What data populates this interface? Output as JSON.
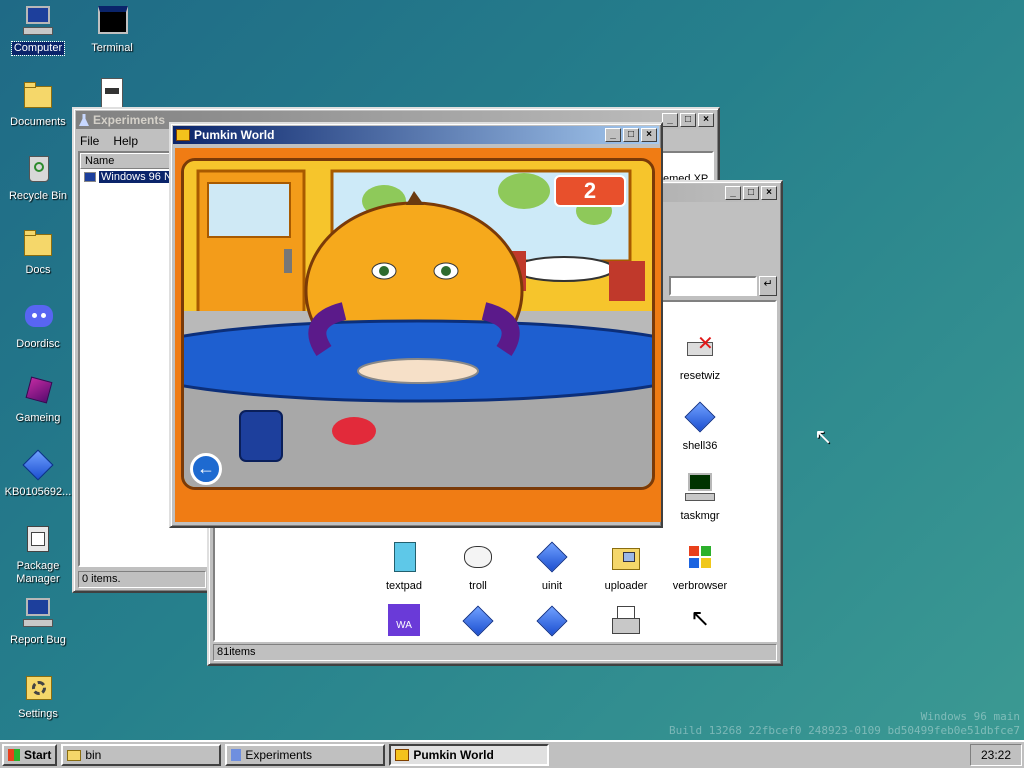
{
  "desktop": {
    "icons": [
      {
        "label": "Computer",
        "icon": "computer-icon"
      },
      {
        "label": "Terminal",
        "icon": "terminal-icon"
      },
      {
        "label": "Documents",
        "icon": "folder-icon"
      },
      {
        "label": "Recycle Bin",
        "icon": "recycle-bin-icon"
      },
      {
        "label": "Docs",
        "icon": "folder-icon"
      },
      {
        "label": "Doordisc",
        "icon": "discord-icon"
      },
      {
        "label": "Gameing",
        "icon": "cube-icon"
      },
      {
        "label": "KB0105692...",
        "icon": "diamond-icon"
      },
      {
        "label": "Package Manager",
        "icon": "package-icon"
      },
      {
        "label": "Report Bug",
        "icon": "monitor-icon"
      },
      {
        "label": "Settings",
        "icon": "settings-icon"
      }
    ],
    "watermark": [
      "Windows 96 main",
      "Build 13268 22fbcef0 248923-0109 bd50499feb0e51dbfce7"
    ]
  },
  "windows": {
    "experiments": {
      "title": "Experiments",
      "menu": [
        "File",
        "Help"
      ],
      "column": "Name",
      "item": "Windows 96 N",
      "status": "0 items.",
      "partial_text": "emed XP"
    },
    "explorer": {
      "status": "81items",
      "files": [
        {
          "label": "resetwiz",
          "icon": "reset-icon"
        },
        {
          "label": "shell36",
          "icon": "diamond-icon"
        },
        {
          "label": "taskmgr",
          "icon": "taskmgr-icon"
        },
        {
          "label": "textpad",
          "icon": "notepad-icon"
        },
        {
          "label": "troll",
          "icon": "trollface-icon"
        },
        {
          "label": "uinit",
          "icon": "diamond-icon"
        },
        {
          "label": "uploader",
          "icon": "uploader-icon"
        },
        {
          "label": "verbrowser",
          "icon": "windows-logo-icon"
        }
      ],
      "wa_label": "WA"
    },
    "pumkin": {
      "title": "Pumkin World",
      "counter": "2"
    }
  },
  "taskbar": {
    "start": "Start",
    "tasks": [
      "bin",
      "Experiments",
      "Pumkin World"
    ],
    "clock": "23:22"
  }
}
